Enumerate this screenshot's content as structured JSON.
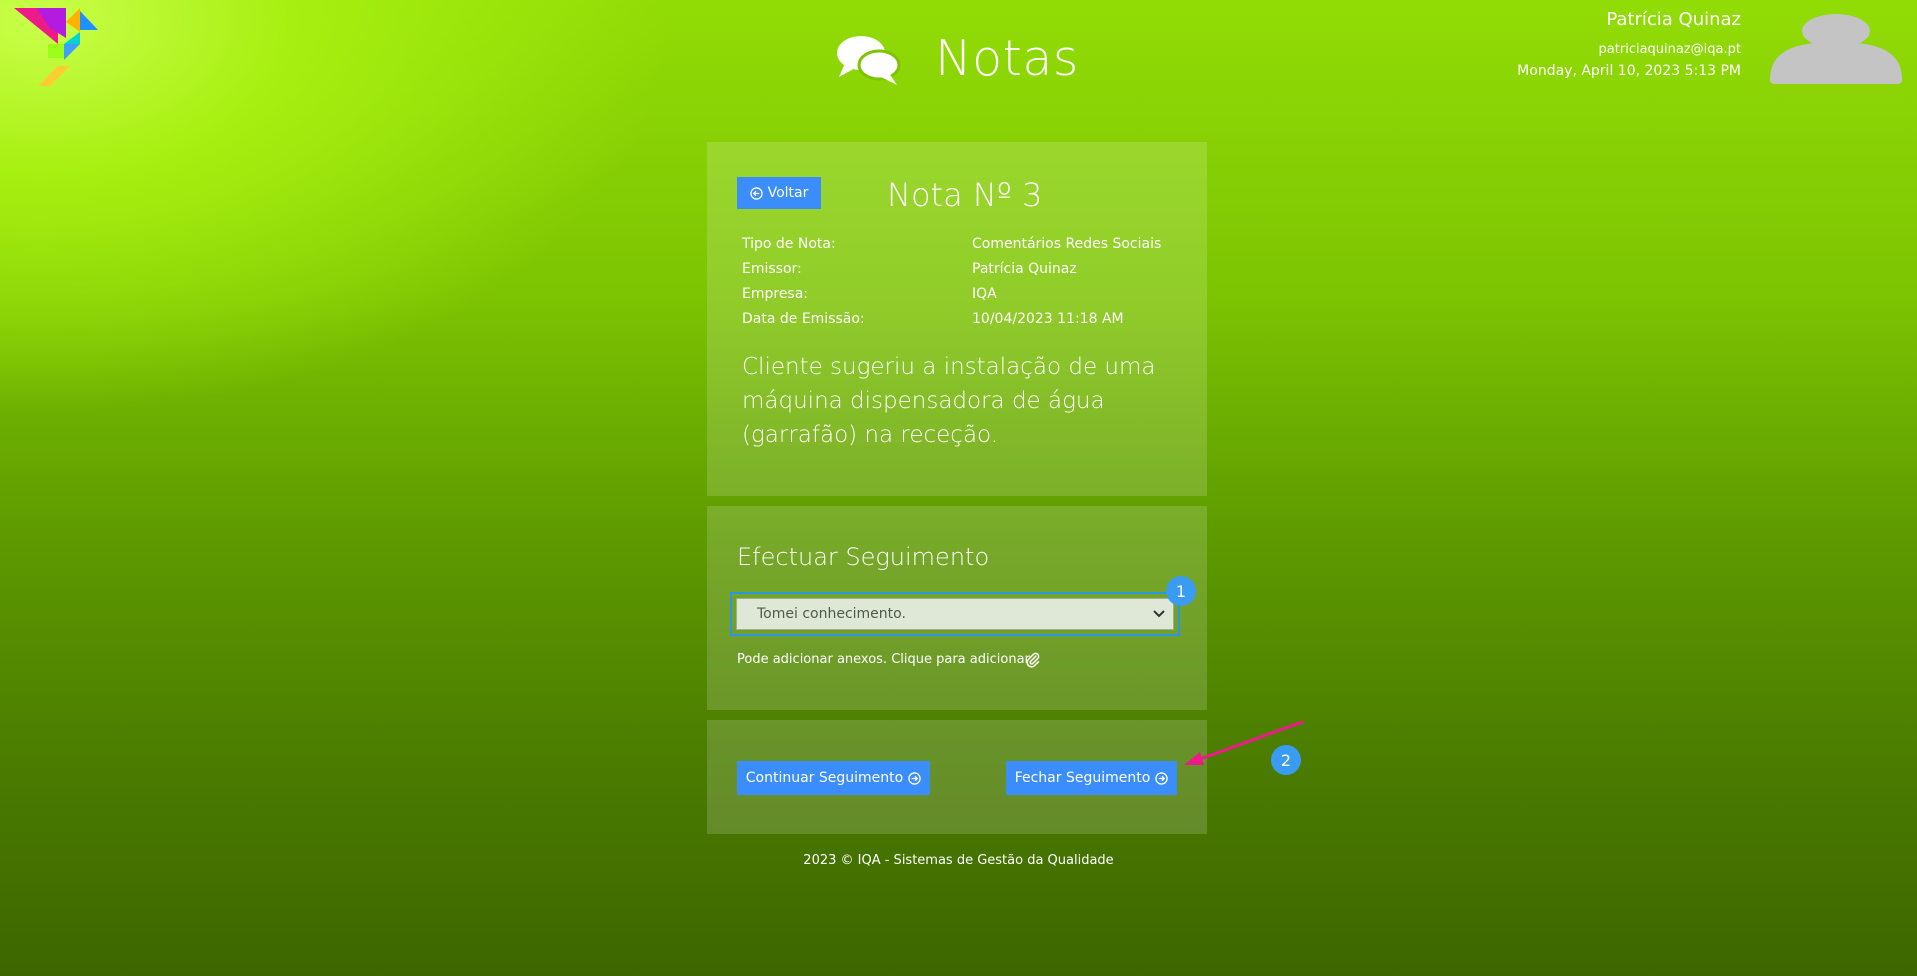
{
  "header": {
    "title": "Notas",
    "user_name": "Patrícia Quinaz",
    "user_email": "patriciaquinaz@iqa.pt",
    "datetime": "Monday, April 10, 2023 5:13 PM"
  },
  "note": {
    "back_label": "Voltar",
    "title": "Nota Nº 3",
    "fields": [
      {
        "label": "Tipo de Nota:",
        "value": "Comentários Redes Sociais"
      },
      {
        "label": "Emissor:",
        "value": "Patrícia Quinaz"
      },
      {
        "label": "Empresa:",
        "value": "IQA"
      },
      {
        "label": "Data de Emissão:",
        "value": "10/04/2023 11:18 AM"
      }
    ],
    "body": "Cliente sugeriu a instalação de uma máquina dispensadora de água (garrafão) na receção."
  },
  "follow_up": {
    "title": "Efectuar Seguimento",
    "selected_option": "Tomei conhecimento.",
    "attach_text": "Pode adicionar anexos. Clique para adicionar"
  },
  "actions": {
    "continue_label": "Continuar Seguimento",
    "close_label": "Fechar Seguimento"
  },
  "markers": [
    "1",
    "2"
  ],
  "footer": "2023 © IQA - Sistemas de Gestão da Qualidade",
  "colors": {
    "button": "#3b8dfb",
    "marker": "#3a9bf2",
    "arrow": "#ef1a8a",
    "avatar": "#c4c4c4"
  },
  "icons": {
    "logo": "tangram-bird-logo",
    "title": "chat-bubbles-icon",
    "back": "arrow-left-circle-icon",
    "attach": "paperclip-icon",
    "continue": "arrow-right-circle-icon",
    "close": "arrow-right-circle-icon"
  }
}
